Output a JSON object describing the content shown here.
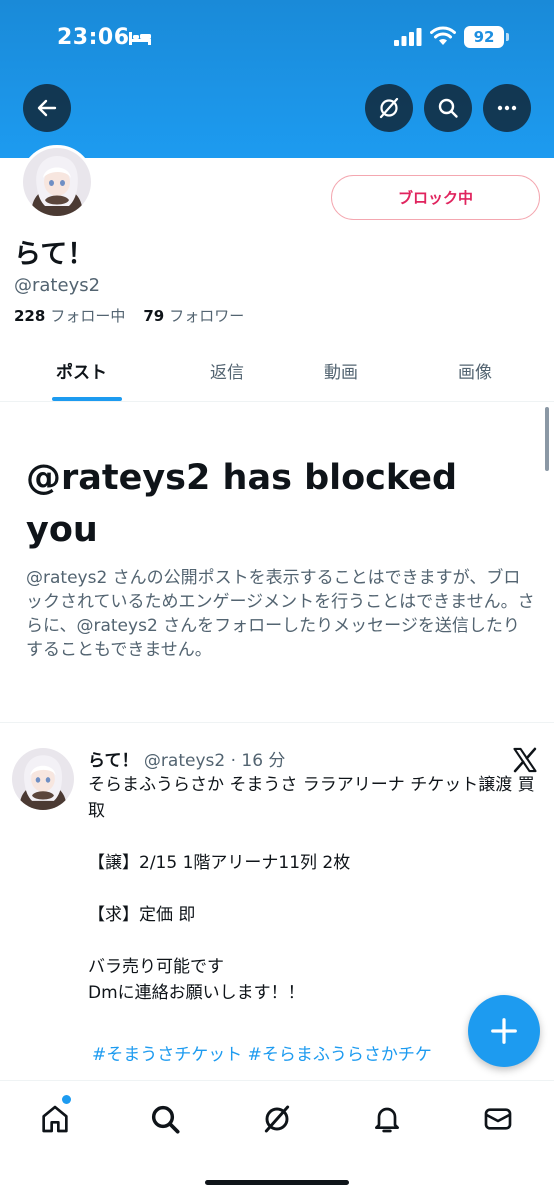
{
  "status_bar": {
    "time": "23:06",
    "battery": "92"
  },
  "profile": {
    "display_name": "らて！",
    "handle": "@rateys2",
    "following_count": "228",
    "following_label": "フォロー中",
    "followers_count": "79",
    "followers_label": "フォロワー",
    "block_button": "ブロック中"
  },
  "tabs": [
    "ポスト",
    "返信",
    "動画",
    "画像"
  ],
  "active_tab": "ポスト",
  "blocked_notice": {
    "title": "@rateys2 has blocked you",
    "description": "@rateys2 さんの公開ポストを表示することはできますが、ブロックされているためエンゲージメントを行うことはできません。さらに、@rateys2 さんをフォローしたりメッセージを送信したりすることもできません。"
  },
  "post": {
    "name": "らて！",
    "meta": "@rateys2 · 16 分",
    "body": "そらまふうらさか そまうさ ララアリーナ チケット譲渡 買取\n\n【譲】2/15 1階アリーナ11列 2枚\n\n【求】定価 即\n\nバラ売り可能です\nDmに連絡お願いします！！",
    "hashtags": "#そまうさチケット #そらまふうらさかチケ"
  },
  "icons": {
    "header": [
      "back-arrow-icon",
      "grok-icon",
      "search-icon",
      "more-icon"
    ],
    "bottom_nav": [
      "home-icon",
      "search-icon",
      "grok-icon",
      "notifications-icon",
      "messages-icon"
    ],
    "fab": "plus-icon"
  },
  "colors": {
    "brand": "#1d9bf0",
    "block_red": "#e0245e",
    "text_secondary": "#536471"
  }
}
